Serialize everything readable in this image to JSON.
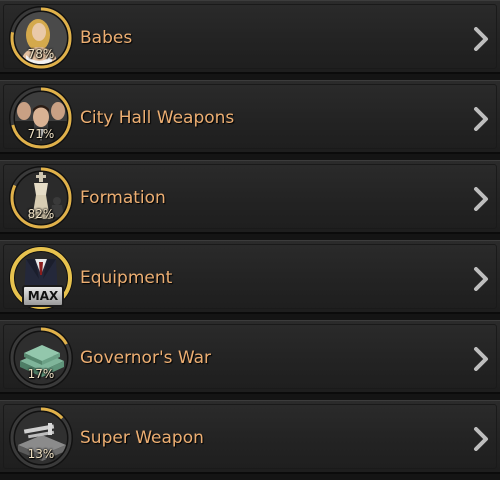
{
  "rows": [
    {
      "label": "Babes",
      "progress_text": "78%",
      "progress": 0.78,
      "icon": "babe-portrait-icon",
      "max": false
    },
    {
      "label": "City Hall Weapons",
      "progress_text": "71%",
      "progress": 0.71,
      "icon": "gangsters-portrait-icon",
      "max": false
    },
    {
      "label": "Formation",
      "progress_text": "82%",
      "progress": 0.82,
      "icon": "chess-king-icon",
      "max": false
    },
    {
      "label": "Equipment",
      "progress_text": "MAX",
      "progress": 1.0,
      "icon": "suit-icon",
      "max": true
    },
    {
      "label": "Governor's War",
      "progress_text": "17%",
      "progress": 0.17,
      "icon": "cash-stack-icon",
      "max": false
    },
    {
      "label": "Super Weapon",
      "progress_text": "13%",
      "progress": 0.13,
      "icon": "weapon-crate-icon",
      "max": false
    }
  ],
  "colors": {
    "label": "#ecae72",
    "progress_ring": "#e0b14a",
    "ring_track": "#3a3a3a",
    "max_ring": "#e7c24e"
  }
}
